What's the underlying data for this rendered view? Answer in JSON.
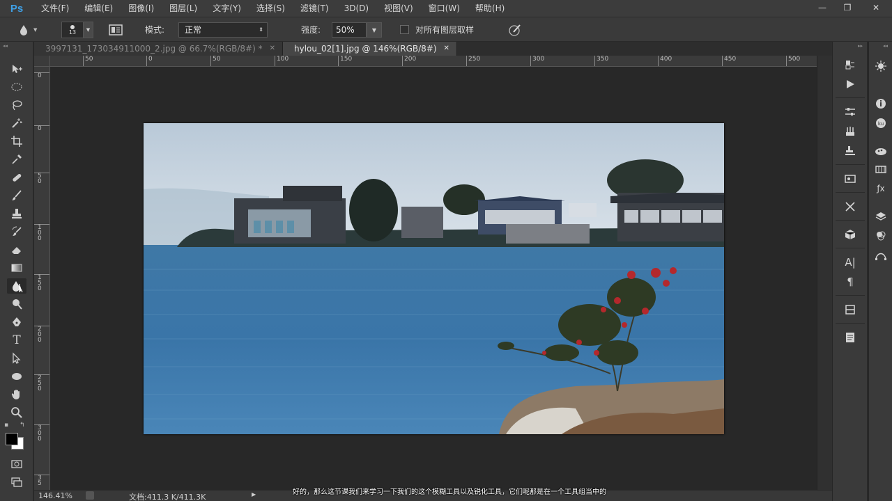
{
  "app": {
    "logo": "Ps"
  },
  "menu": [
    "文件(F)",
    "编辑(E)",
    "图像(I)",
    "图层(L)",
    "文字(Y)",
    "选择(S)",
    "滤镜(T)",
    "3D(D)",
    "视图(V)",
    "窗口(W)",
    "帮助(H)"
  ],
  "window_controls": {
    "minimize": "—",
    "restore": "❐",
    "close": "✕"
  },
  "options": {
    "brush_size": "13",
    "mode_label": "模式:",
    "mode_value": "正常",
    "strength_label": "强度:",
    "strength_value": "50%",
    "sample_all_label": "对所有图层取样",
    "sample_all_checked": false
  },
  "tabs": [
    {
      "label": "3997131_173034911000_2.jpg @ 66.7%(RGB/8#) *",
      "active": false
    },
    {
      "label": "hylou_02[1].jpg @ 146%(RGB/8#)",
      "active": true
    }
  ],
  "ruler_h": [
    "50",
    "0",
    "50",
    "100",
    "150",
    "200",
    "250",
    "300",
    "350",
    "400",
    "450",
    "500"
  ],
  "ruler_v": [
    "0",
    "0",
    "5\n0",
    "1\n0\n0",
    "1\n5\n0",
    "2\n0\n0",
    "2\n5\n0",
    "3\n0\n0",
    "3\n5"
  ],
  "status": {
    "zoom": "146.41%",
    "doc": "文档:411.3 K/411.3K"
  },
  "subtitle": "好的，那么这节课我们来学习一下我们的这个模糊工具以及锐化工具，它们呢那是在一个工具组当中的",
  "tools": [
    "move-tool",
    "marquee-tool",
    "lasso-tool",
    "magic-wand-tool",
    "crop-tool",
    "eyedropper-tool",
    "healing-brush-tool",
    "brush-tool",
    "clone-stamp-tool",
    "history-brush-tool",
    "eraser-tool",
    "gradient-tool",
    "blur-tool",
    "dodge-tool",
    "pen-tool",
    "type-tool",
    "path-selection-tool",
    "ellipse-tool",
    "hand-tool",
    "zoom-tool"
  ],
  "colors": {
    "foreground": "#000000",
    "background": "#ffffff",
    "accent": "#3fa0e6"
  }
}
